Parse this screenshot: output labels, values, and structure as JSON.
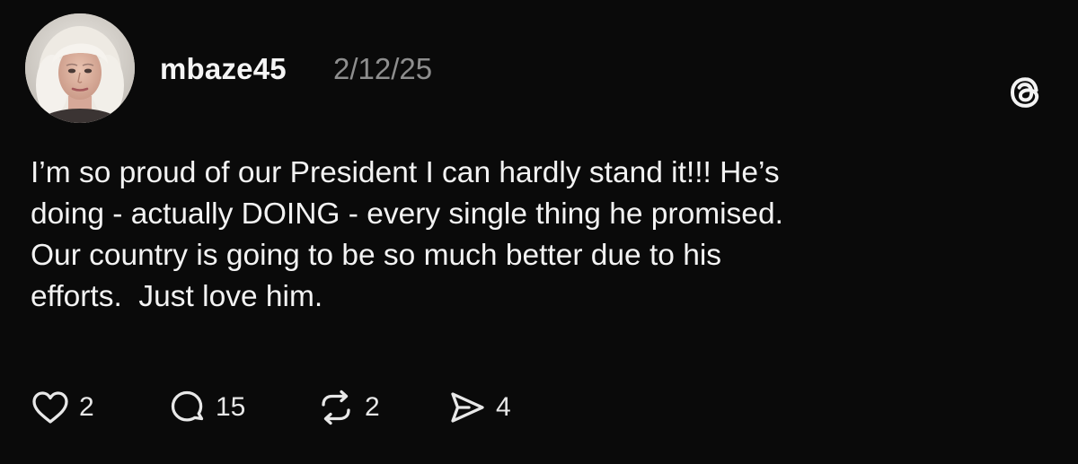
{
  "post": {
    "username": "mbaze45",
    "date": "2/12/25",
    "text": "I’m so proud of our President I can hardly stand it!!! He’s\ndoing - actually DOING - every single thing he promised.\nOur country is going to be so much better due to his\nefforts.  Just love him.",
    "actions": {
      "likes": "2",
      "replies": "15",
      "reposts": "2",
      "shares": "4"
    }
  },
  "icons": {
    "like": "heart-icon",
    "reply": "speech-bubble-icon",
    "repost": "repost-arrows-icon",
    "share": "send-arrow-icon",
    "brand": "threads-logo-icon"
  },
  "colors": {
    "background": "#0a0a0a",
    "text": "#f3f3f3",
    "muted": "#8e8e8e"
  }
}
